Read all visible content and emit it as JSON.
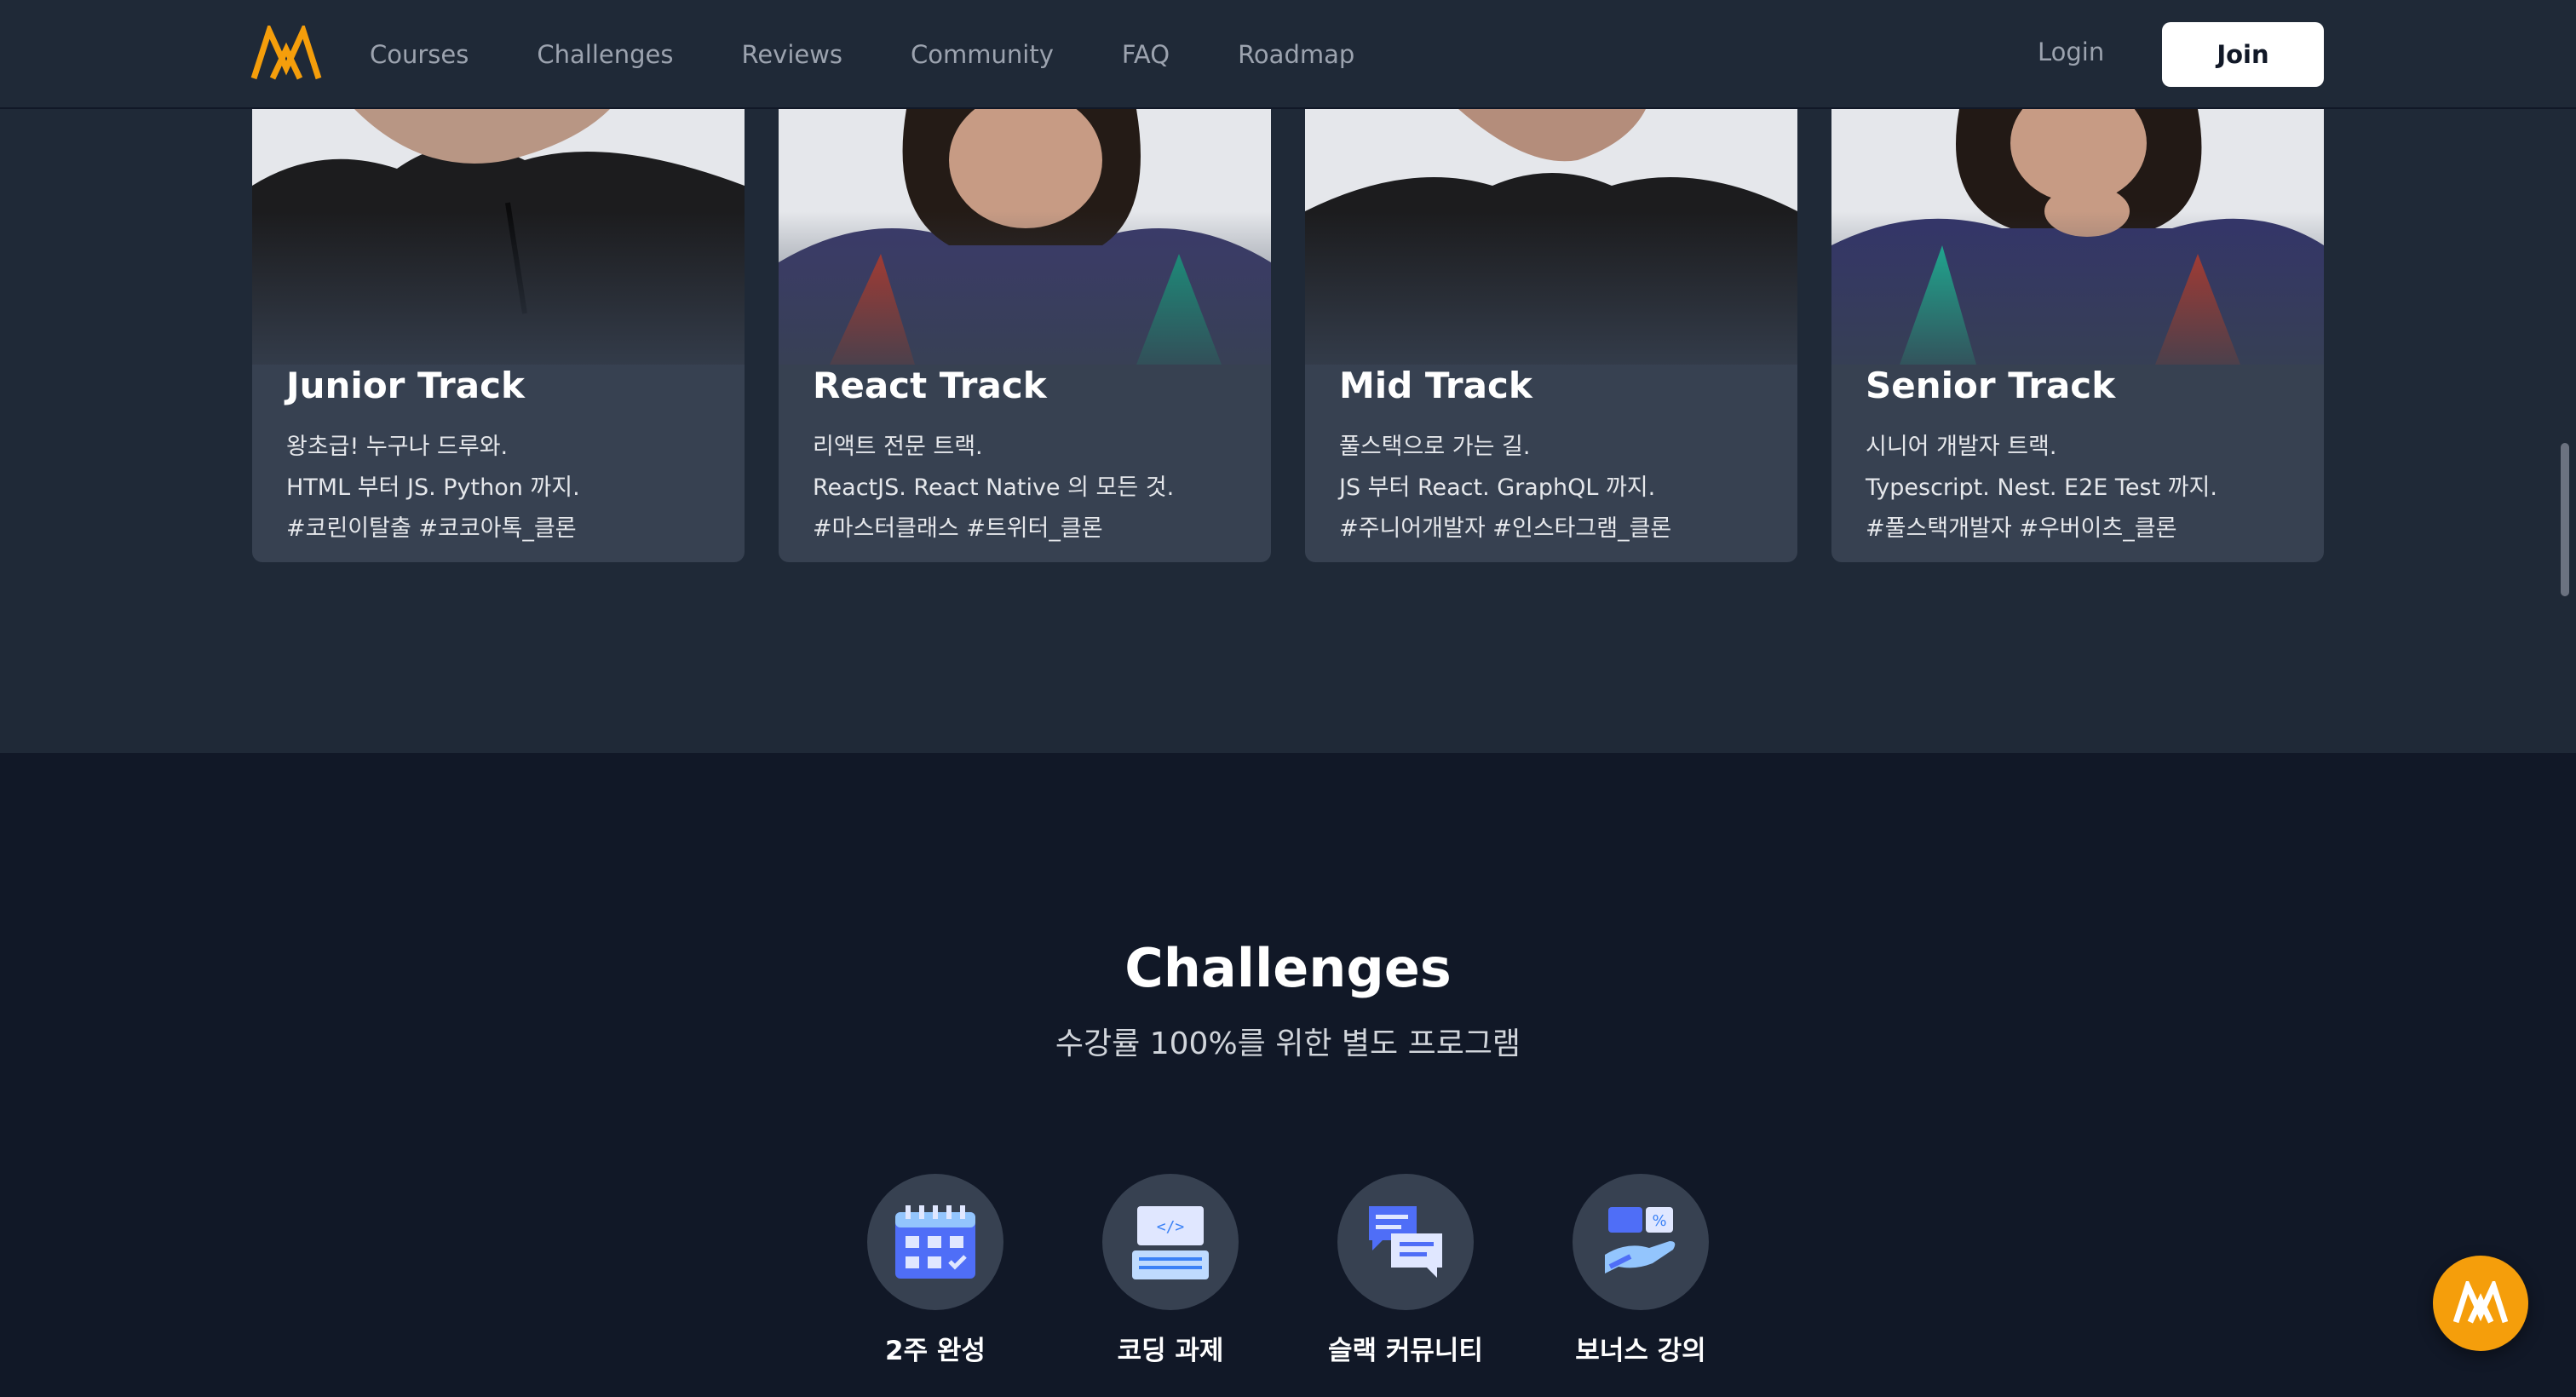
{
  "header": {
    "nav": [
      "Courses",
      "Challenges",
      "Reviews",
      "Community",
      "FAQ",
      "Roadmap"
    ],
    "login_label": "Login",
    "join_label": "Join"
  },
  "tracks": [
    {
      "title": "Junior Track",
      "line1": "왕초급! 누구나 드루와.",
      "line2": "HTML 부터 JS. Python 까지.",
      "line3": "#코린이탈출 #코코아톡_클론"
    },
    {
      "title": "React Track",
      "line1": "리액트 전문 트랙.",
      "line2": "ReactJS. React Native 의 모든 것.",
      "line3": "#마스터클래스 #트위터_클론"
    },
    {
      "title": "Mid Track",
      "line1": "풀스택으로 가는 길.",
      "line2": "JS 부터 React. GraphQL 까지.",
      "line3": "#주니어개발자 #인스타그램_클론"
    },
    {
      "title": "Senior Track",
      "line1": "시니어 개발자 트랙.",
      "line2": "Typescript. Nest. E2E Test 까지.",
      "line3": "#풀스택개발자 #우버이츠_클론"
    }
  ],
  "challenges": {
    "title": "Challenges",
    "subtitle": "수강률 100%를 위한 별도 프로그램",
    "features": [
      {
        "label": "2주 완성",
        "icon": "calendar-icon"
      },
      {
        "label": "코딩 과제",
        "icon": "coding-window-icon"
      },
      {
        "label": "슬랙 커뮤니티",
        "icon": "chat-bubbles-icon"
      },
      {
        "label": "보너스 강의",
        "icon": "bonus-hand-icon"
      }
    ]
  },
  "colors": {
    "accent": "#f59e0b",
    "header_bg": "#1f2937",
    "card_bg": "#374151",
    "page_bg": "#111827",
    "icon_blue": "#3b82f6"
  }
}
